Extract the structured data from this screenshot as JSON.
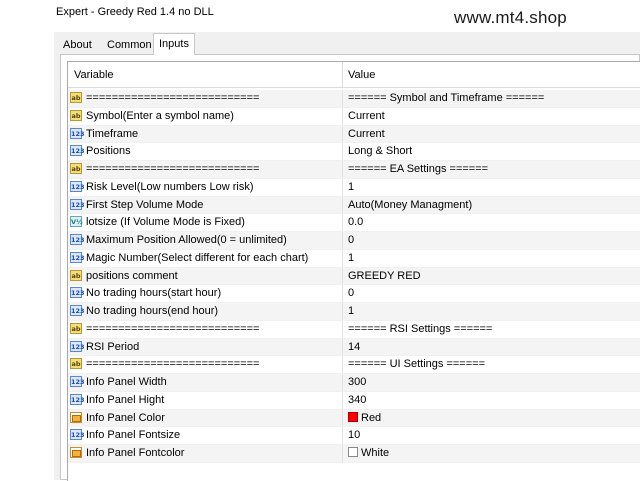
{
  "window": {
    "title": "Expert - Greedy Red 1.4 no DLL"
  },
  "watermark": "www.mt4.shop",
  "tabs": [
    {
      "label": "About"
    },
    {
      "label": "Common"
    },
    {
      "label": "Inputs"
    }
  ],
  "table": {
    "header": {
      "variable": "Variable",
      "value": "Value"
    },
    "rows": [
      {
        "icon": "ab",
        "variable": "===========================",
        "value": "======  Symbol and Timeframe  ======"
      },
      {
        "icon": "ab",
        "variable": "Symbol(Enter a symbol name)",
        "value": "Current"
      },
      {
        "icon": "123",
        "variable": "Timeframe",
        "value": "Current"
      },
      {
        "icon": "123",
        "variable": "Positions",
        "value": "Long & Short"
      },
      {
        "icon": "ab",
        "variable": "===========================",
        "value": "======  EA Settings  ======"
      },
      {
        "icon": "123",
        "variable": "Risk Level(Low numbers Low risk)",
        "value": "1"
      },
      {
        "icon": "123",
        "variable": "First Step Volume Mode",
        "value": "Auto(Money Managment)"
      },
      {
        "icon": "ve",
        "variable": "lotsize (If Volume Mode is Fixed)",
        "value": "0.0"
      },
      {
        "icon": "123",
        "variable": "Maximum Position Allowed(0 = unlimited)",
        "value": "0"
      },
      {
        "icon": "123",
        "variable": "Magic Number(Select different for each chart)",
        "value": "1"
      },
      {
        "icon": "ab",
        "variable": "positions  comment",
        "value": "GREEDY RED"
      },
      {
        "icon": "123",
        "variable": "No trading hours(start hour)",
        "value": "0"
      },
      {
        "icon": "123",
        "variable": "No trading hours(end hour)",
        "value": "1"
      },
      {
        "icon": "ab",
        "variable": "===========================",
        "value": "======  RSI Settings  ======"
      },
      {
        "icon": "123",
        "variable": "RSI Period",
        "value": "14"
      },
      {
        "icon": "ab",
        "variable": "===========================",
        "value": "======  UI Settings  ======"
      },
      {
        "icon": "123",
        "variable": "Info Panel Width",
        "value": "300"
      },
      {
        "icon": "123",
        "variable": "Info Panel Hight",
        "value": "340"
      },
      {
        "icon": "color",
        "variable": "Info Panel Color",
        "value": "Red",
        "swatch": "#ff0000"
      },
      {
        "icon": "123",
        "variable": "Info Panel Fontsize",
        "value": "10"
      },
      {
        "icon": "color",
        "variable": "Info Panel Fontcolor",
        "value": "White",
        "swatch": "#ffffff"
      }
    ]
  }
}
